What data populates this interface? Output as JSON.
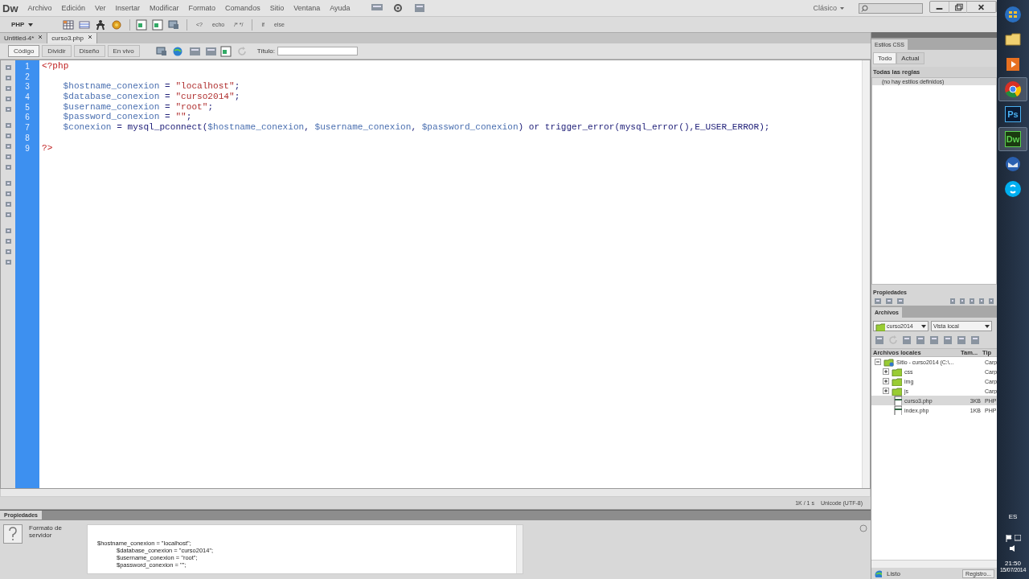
{
  "app": {
    "logo": "Dw",
    "menu": [
      "Archivo",
      "Edición",
      "Ver",
      "Insertar",
      "Modificar",
      "Formato",
      "Comandos",
      "Sitio",
      "Ventana",
      "Ayuda"
    ],
    "workspace": "Clásico"
  },
  "insert_toolbar": {
    "category": "PHP",
    "snippets": [
      "<?",
      "echo",
      "/* */",
      "if",
      "else"
    ]
  },
  "doc_tabs": [
    {
      "label": "Untitled-4*",
      "selected": false
    },
    {
      "label": "curso3.php",
      "selected": true
    }
  ],
  "view_buttons": [
    {
      "label": "Código",
      "selected": true
    },
    {
      "label": "Dividir",
      "selected": false
    },
    {
      "label": "Diseño",
      "selected": false
    },
    {
      "label": "En vivo",
      "selected": false
    }
  ],
  "title_field": {
    "label": "Título:"
  },
  "code": {
    "lines": [
      {
        "number": "1",
        "indented": false,
        "tokens": [
          {
            "text": "<?php",
            "kind": "tag"
          }
        ]
      },
      {
        "number": "2"
      },
      {
        "number": "3",
        "indented": true,
        "tokens": [
          {
            "text": "$hostname_conexion",
            "kind": "var"
          },
          {
            "text": " = ",
            "kind": "op"
          },
          {
            "text": "\"localhost\"",
            "kind": "str"
          },
          {
            "text": ";",
            "kind": "op"
          }
        ]
      },
      {
        "number": "4",
        "indented": true,
        "tokens": [
          {
            "text": "$database_conexion",
            "kind": "var"
          },
          {
            "text": " = ",
            "kind": "op"
          },
          {
            "text": "\"curso2014\"",
            "kind": "str"
          },
          {
            "text": ";",
            "kind": "op"
          }
        ]
      },
      {
        "number": "5",
        "indented": true,
        "tokens": [
          {
            "text": "$username_conexion",
            "kind": "var"
          },
          {
            "text": " = ",
            "kind": "op"
          },
          {
            "text": "\"root\"",
            "kind": "str"
          },
          {
            "text": ";",
            "kind": "op"
          }
        ]
      },
      {
        "number": "6",
        "indented": true,
        "tokens": [
          {
            "text": "$password_conexion",
            "kind": "var"
          },
          {
            "text": " = ",
            "kind": "op"
          },
          {
            "text": "\"\"",
            "kind": "str"
          },
          {
            "text": ";",
            "kind": "op"
          }
        ]
      },
      {
        "number": "7",
        "indented": true,
        "tokens": [
          {
            "text": "$conexion",
            "kind": "var"
          },
          {
            "text": " = mysql_pconnect(",
            "kind": "op"
          },
          {
            "text": "$hostname_conexion",
            "kind": "var"
          },
          {
            "text": ", ",
            "kind": "op"
          },
          {
            "text": "$username_conexion",
            "kind": "var"
          },
          {
            "text": ", ",
            "kind": "op"
          },
          {
            "text": "$password_conexion",
            "kind": "var"
          },
          {
            "text": ") or trigger_error(mysql_error(),E_USER_ERROR);",
            "kind": "op"
          }
        ]
      },
      {
        "number": "8"
      },
      {
        "number": "9",
        "indented": false,
        "tokens": [
          {
            "text": "?>",
            "kind": "tag"
          }
        ]
      }
    ]
  },
  "status": {
    "size": "1K / 1 s",
    "encoding": "Unicode (UTF-8)"
  },
  "properties": {
    "tab": "Propiedades",
    "format_label": "Formato de servidor",
    "preview_lines": [
      {
        "text": "$hostname_conexion = \"localhost\";",
        "indented": false
      },
      {
        "text": "$database_conexion = \"curso2014\";",
        "indented": true
      },
      {
        "text": "$username_conexion = \"root\";",
        "indented": true
      },
      {
        "text": "$password_conexion = \"\";",
        "indented": true
      }
    ]
  },
  "css_panel": {
    "tab": "Estilos CSS",
    "modes": [
      {
        "label": "Todo",
        "selected": true
      },
      {
        "label": "Actual",
        "selected": false
      }
    ],
    "header": "Todas las reglas",
    "empty_note": "(no hay estilos definidos)",
    "properties_header": "Propiedades"
  },
  "files_panel": {
    "tab": "Archivos",
    "site": "curso2014",
    "view": "Vista local",
    "columns": [
      "Archivos locales",
      "Tam...",
      "Tip"
    ],
    "tree": [
      {
        "name": "Sitio - curso2014 (C:\\...",
        "type": "Carp",
        "kind": "site",
        "expanded": true,
        "selected": false,
        "children": [
          {
            "name": "css",
            "type": "Carp",
            "kind": "folder",
            "expanded": false,
            "selected": false
          },
          {
            "name": "img",
            "type": "Carp",
            "kind": "folder",
            "expanded": false,
            "selected": false
          },
          {
            "name": "js",
            "type": "Carp",
            "kind": "folder",
            "expanded": false,
            "selected": false
          },
          {
            "name": "curso3.php",
            "size": "3KB",
            "type": "PHP",
            "kind": "file",
            "selected": true
          },
          {
            "name": "index.php",
            "size": "1KB",
            "type": "PHP",
            "kind": "file",
            "selected": false
          }
        ]
      }
    ],
    "status": "Listo",
    "log_button": "Registro..."
  },
  "taskbar": {
    "apps": [
      {
        "kind": "start",
        "active": false
      },
      {
        "kind": "folder",
        "active": false
      },
      {
        "kind": "media",
        "active": false
      },
      {
        "kind": "chrome",
        "active": true
      },
      {
        "kind": "ps",
        "label": "Ps",
        "active": false
      },
      {
        "kind": "dw",
        "label": "Dw",
        "active": true
      },
      {
        "kind": "mail",
        "active": false
      },
      {
        "kind": "skype",
        "active": false
      }
    ],
    "language": "ES",
    "time": "21:50",
    "date": "15/07/2014"
  }
}
